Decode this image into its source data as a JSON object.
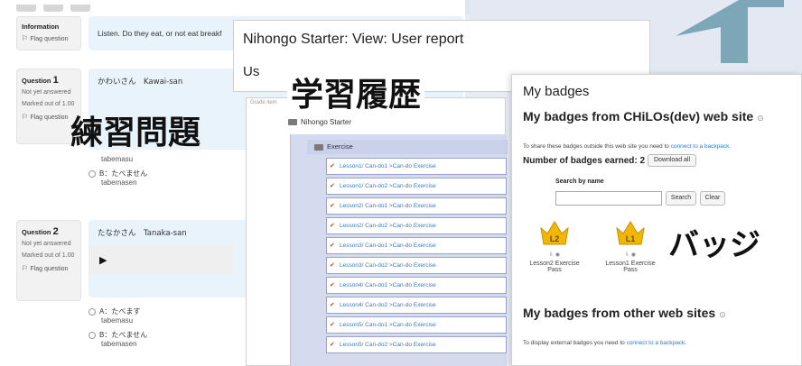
{
  "quiz": {
    "info_label": "Information",
    "flag_label": "Flag question",
    "info_text": "Listen. Do they eat, or not eat breakf",
    "q1": {
      "label": "Question",
      "number": "1",
      "status": "Not yet answered",
      "marked": "Marked out of 1.00",
      "flag": "Flag question",
      "speaker": "かわいさん　Kawai-san",
      "opt_b_jp": "B：たべません",
      "opt_b_rom": "tabemasen",
      "opt_a_rom": "tabemasu"
    },
    "q2": {
      "label": "Question",
      "number": "2",
      "status": "Not yet answered",
      "marked": "Marked out of 1.00",
      "flag": "Flag question",
      "speaker": "たなかさん　Tanaka-san",
      "opt_a_jp": "A：たべます",
      "opt_a_rom": "tabemasu",
      "opt_b_jp": "B：たべません",
      "opt_b_rom": "tabemasen"
    }
  },
  "report": {
    "title": "Nihongo Starter: View: User report",
    "subtitle": "Us",
    "grade_label": "Grade item",
    "course": "Nihongo Starter",
    "category": "Exercise",
    "items": [
      "Lesson1/ Can-do1 >Can-do Exercise",
      "Lesson1/ Can-do2 >Can-do Exercise",
      "Lesson2/ Can-do1 >Can-do Exercise",
      "Lesson2/ Can-do2 >Can-do Exercise",
      "Lesson3/ Can-do1 >Can-do Exercise",
      "Lesson3/ Can-do2 >Can-do Exercise",
      "Lesson4/ Can-do1 >Can-do Exercise",
      "Lesson4/ Can-do2 >Can-do Exercise",
      "Lesson5/ Can-do1 >Can-do Exercise",
      "Lesson5/ Can-do2 >Can-do Exercise"
    ]
  },
  "badges": {
    "title": "My badges",
    "from_site": "My badges from CHiLOs(dev) web site",
    "share_text": "To share these badges outside this web site you need to ",
    "share_link": "connect to a backpack",
    "earned": "Number of badges earned: 2",
    "download_all": "Download all",
    "search_by_name": "Search by name",
    "search_btn": "Search",
    "clear_btn": "Clear",
    "list": [
      {
        "level": "L2",
        "name": "Lesson2 Exercise Pass"
      },
      {
        "level": "L1",
        "name": "Lesson1 Exercise Pass"
      }
    ],
    "from_other": "My badges from other web sites",
    "ext_text": "To display external badges you need to ",
    "ext_link": "connect to a backpack"
  },
  "captions": {
    "practice": "練習問題",
    "history": "学習履歴",
    "badge": "バッジ"
  },
  "colors": {
    "accent_blue": "#2a7ae2",
    "question_bg": "#e8f3fb",
    "grade_bg": "#d5dbef",
    "crown_gold": "#f2b705"
  }
}
